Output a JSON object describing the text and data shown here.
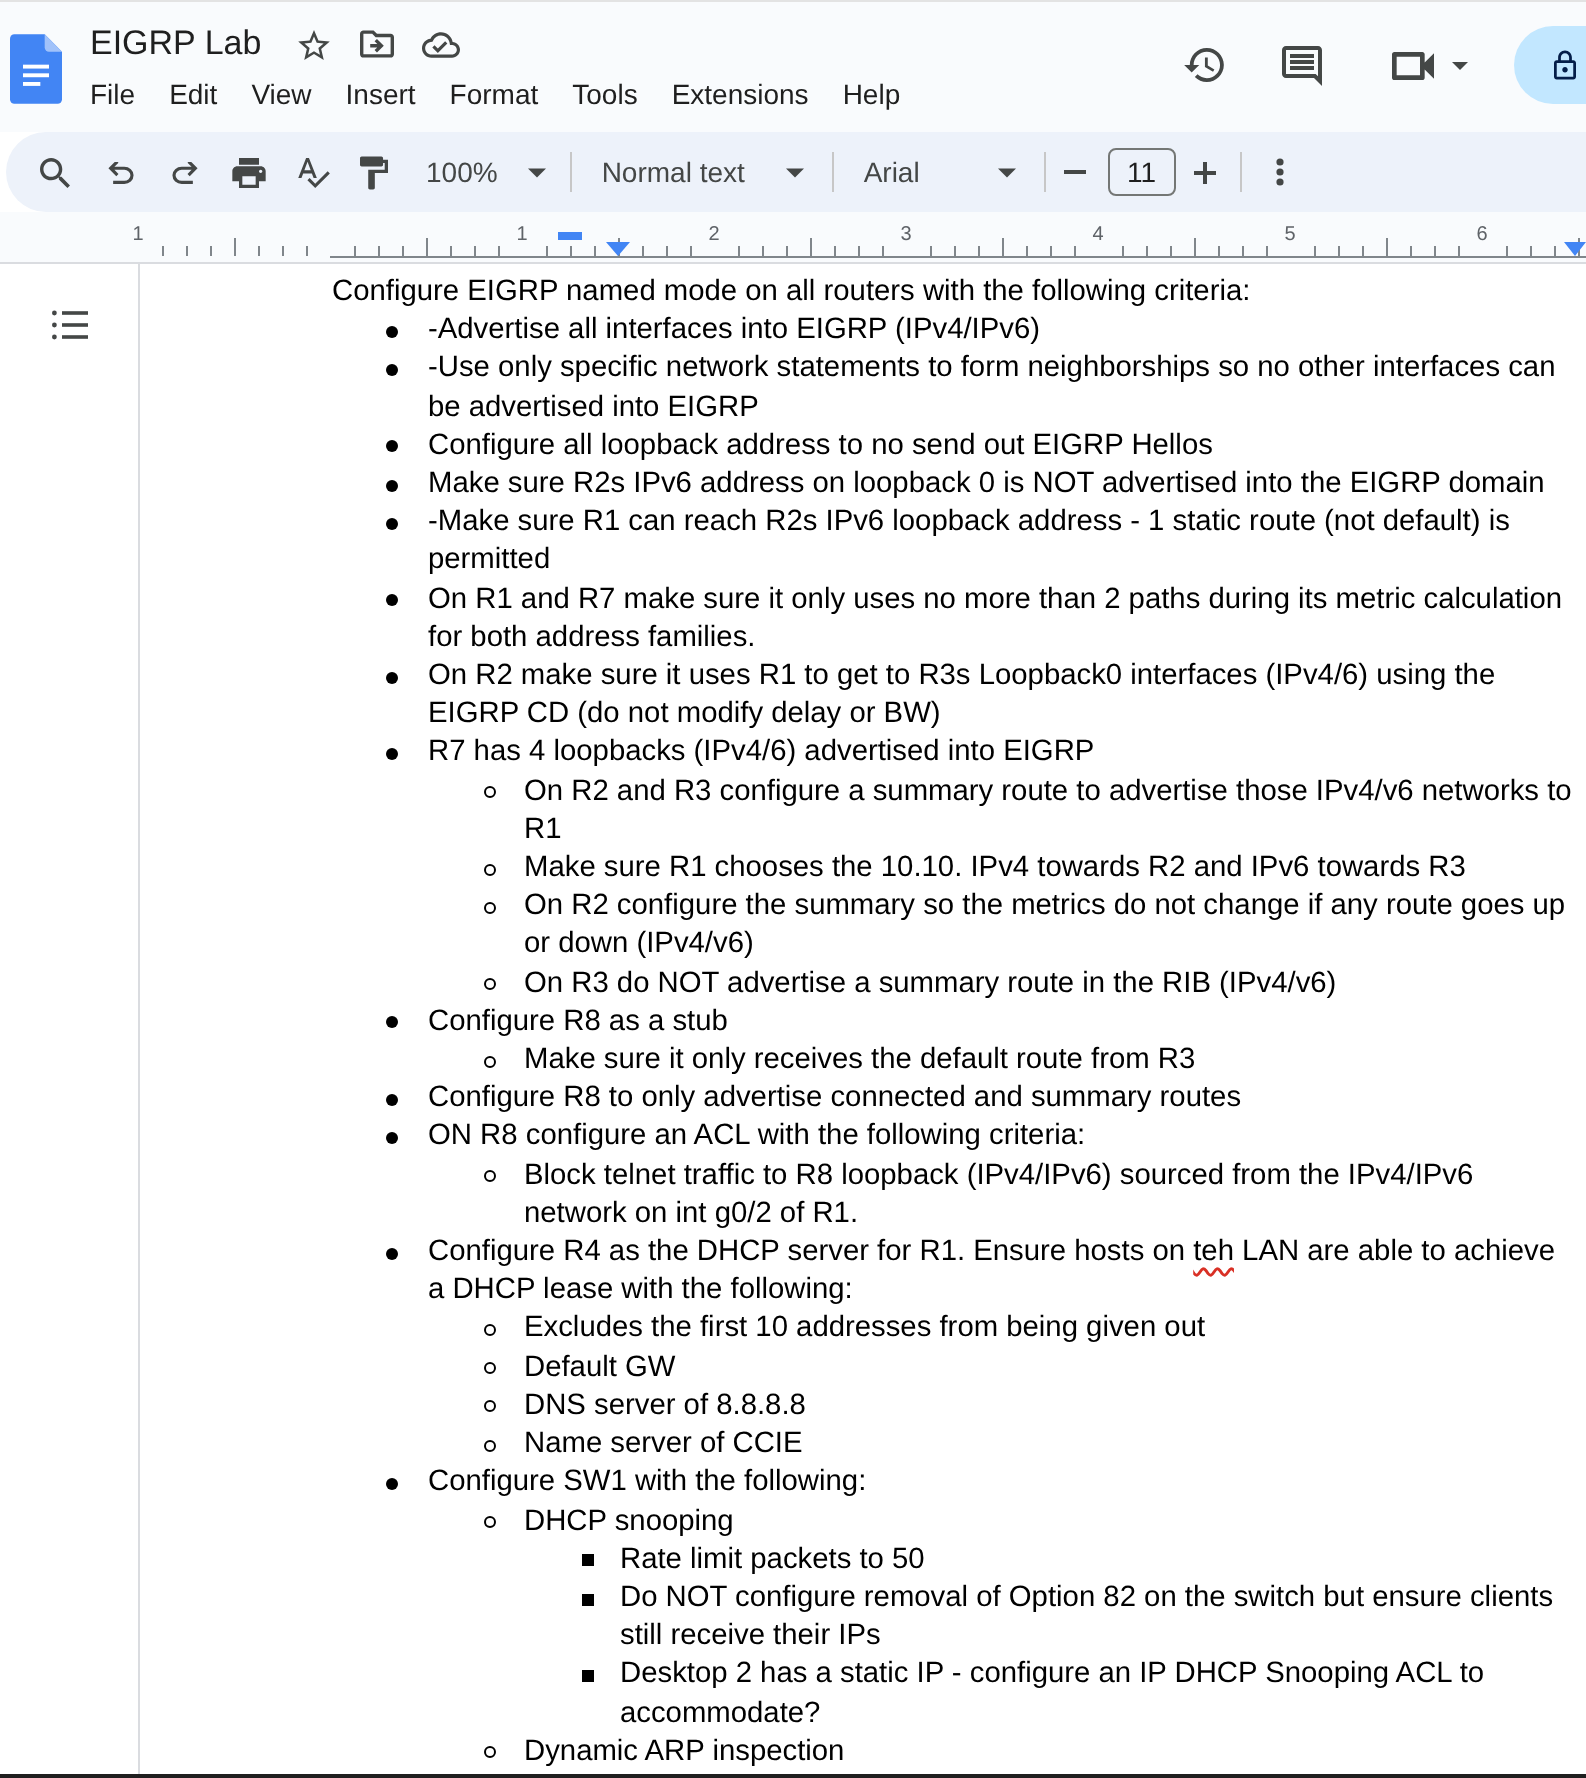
{
  "header": {
    "title": "EIGRP Lab",
    "menu": [
      "File",
      "Edit",
      "View",
      "Insert",
      "Format",
      "Tools",
      "Extensions",
      "Help"
    ]
  },
  "toolbar": {
    "zoom": "100%",
    "paragraph_style": "Normal text",
    "font": "Arial",
    "font_size": "11"
  },
  "ruler": {
    "labels": [
      "1",
      "1",
      "2",
      "3",
      "4",
      "5",
      "6"
    ]
  },
  "document": {
    "intro": "Configure EIGRP named mode on all routers with the following criteria:",
    "items": [
      {
        "text": "-Advertise all interfaces into EIGRP (IPv4/IPv6)"
      },
      {
        "text": "-Use only specific network statements to form neighborships so no other interfaces can be advertised into EIGRP"
      },
      {
        "text": "Configure all loopback address to no send out EIGRP Hellos"
      },
      {
        "text": "Make sure R2s IPv6 address on loopback 0 is NOT advertised into the EIGRP domain"
      },
      {
        "text": "-Make sure R1 can reach R2s IPv6 loopback address - 1 static route (not default) is permitted"
      },
      {
        "text": "On R1 and R7 make sure it only uses no more than 2 paths during its metric calculation for both address families."
      },
      {
        "text": "On R2 make sure it uses R1 to get to R3s Loopback0 interfaces (IPv4/6) using the EIGRP CD (do not modify delay or BW)"
      },
      {
        "text": "R7 has 4 loopbacks (IPv4/6) advertised into EIGRP",
        "children": [
          {
            "text": "On R2 and R3 configure a summary route to advertise those IPv4/v6 networks to R1"
          },
          {
            "text": "Make sure R1 chooses the 10.10. IPv4 towards R2 and IPv6 towards R3"
          },
          {
            "text": "On R2 configure the summary so the metrics do not change if any route goes up or down (IPv4/v6)"
          },
          {
            "text": "On R3 do NOT advertise a summary route in the RIB (IPv4/v6)"
          }
        ]
      },
      {
        "text": "Configure R8 as a stub",
        "children": [
          {
            "text": "Make sure it only receives the default route from R3"
          }
        ]
      },
      {
        "text": "Configure R8 to only advertise connected and summary routes"
      },
      {
        "text": "ON R8 configure an ACL with the following criteria:",
        "children": [
          {
            "text": "Block telnet traffic to R8 loopback (IPv4/IPv6) sourced from the IPv4/IPv6 network on int g0/2 of R1."
          }
        ]
      },
      {
        "segments": [
          {
            "text": "Configure R4 as the DHCP server for R1. Ensure hosts on ",
            "misspelled": false
          },
          {
            "text": "teh",
            "misspelled": true
          },
          {
            "text": " LAN are able to achieve a DHCP lease with the following:",
            "misspelled": false
          }
        ],
        "children": [
          {
            "text": "Excludes the first 10 addresses from being given out"
          },
          {
            "text": "Default GW"
          },
          {
            "text": "DNS server of 8.8.8.8"
          },
          {
            "text": "Name server of CCIE"
          }
        ]
      },
      {
        "text": "Configure SW1 with the following:",
        "children": [
          {
            "text": "DHCP snooping",
            "children": [
              {
                "text": "Rate limit packets to 50"
              },
              {
                "text": "Do NOT configure removal of Option 82 on the switch but ensure clients still receive their IPs"
              },
              {
                "text": "Desktop 2 has a static IP - configure an IP DHCP Snooping ACL to accommodate?"
              }
            ]
          },
          {
            "text": "Dynamic ARP inspection"
          }
        ]
      }
    ]
  }
}
